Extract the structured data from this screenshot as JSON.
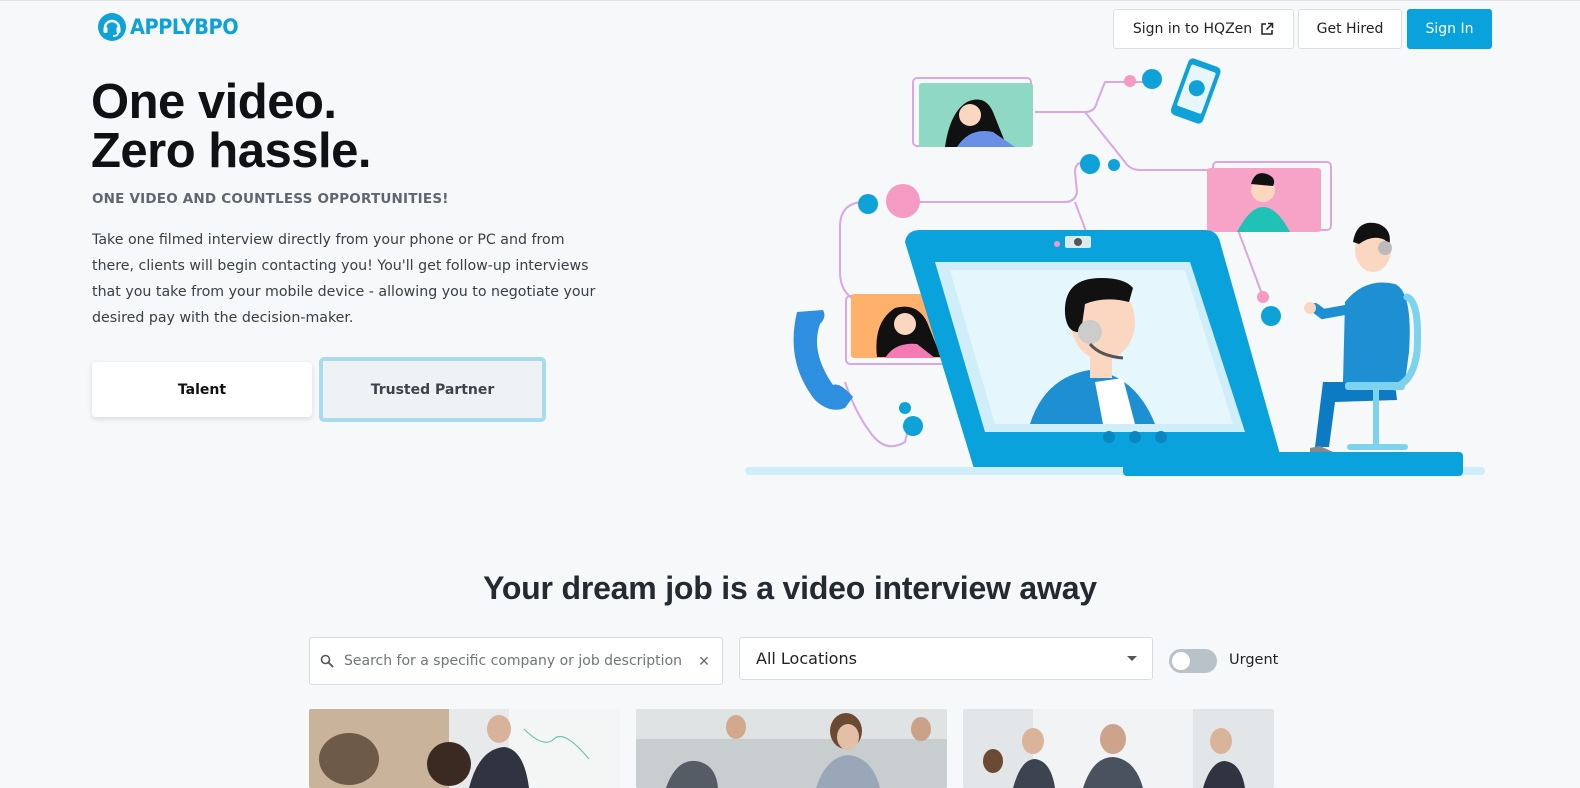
{
  "header": {
    "logo_text": "APPLYBPO",
    "hqzen_label": "Sign in to HQZen",
    "get_hired_label": "Get Hired",
    "sign_in_label": "Sign In"
  },
  "hero": {
    "title_line1": "One video.",
    "title_line2": "Zero hassle.",
    "subtitle": "ONE VIDEO AND COUNTLESS OPPORTUNITIES!",
    "description": "Take one filmed interview directly from your phone or PC and from there, clients will begin contacting you! You'll get follow-up interviews that you take from your mobile device - allowing you to negotiate your desired pay with the decision-maker.",
    "talent_label": "Talent",
    "partner_label": "Trusted Partner"
  },
  "jobs": {
    "section_title": "Your dream job is a video interview away",
    "search_placeholder": "Search for a specific company or job description",
    "search_value": "",
    "location_selected": "All Locations",
    "urgent_label": "Urgent",
    "urgent_on": false
  },
  "colors": {
    "brand": "#0aa2dc",
    "accent_pink": "#f59ac2",
    "accent_green": "#8ed8c4",
    "accent_orange": "#ffb06a"
  },
  "icons": [
    "logo-headset-icon",
    "external-link-icon",
    "search-icon",
    "clear-icon",
    "dropdown-caret-icon"
  ]
}
